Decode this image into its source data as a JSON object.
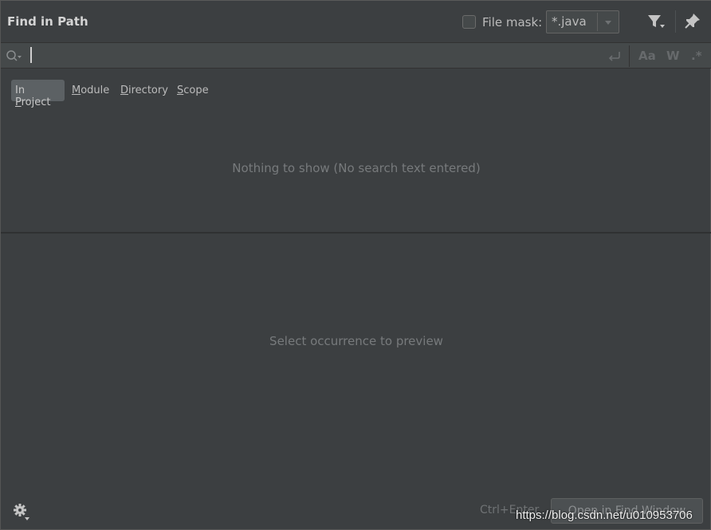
{
  "header": {
    "title": "Find in Path",
    "file_mask_label": "File mask:",
    "file_mask_checked": false,
    "file_mask_value": "*.java",
    "icons": [
      "filter-icon",
      "pin-icon"
    ]
  },
  "search": {
    "value": "",
    "placeholder": "",
    "options": {
      "match_case": "Aa",
      "words": "W",
      "regex": ".*"
    },
    "icons": [
      "search-history-icon",
      "newline-icon"
    ]
  },
  "scopes": {
    "active": "In Project",
    "items": [
      {
        "prefix": "In ",
        "mnemonic": "P",
        "rest": "roject"
      },
      {
        "prefix": "",
        "mnemonic": "M",
        "rest": "odule"
      },
      {
        "prefix": "",
        "mnemonic": "D",
        "rest": "irectory"
      },
      {
        "prefix": "",
        "mnemonic": "S",
        "rest": "cope"
      }
    ]
  },
  "results": {
    "empty_text": "Nothing to show (No search text entered)"
  },
  "preview": {
    "empty_text": "Select occurrence to preview"
  },
  "footer": {
    "shortcut": "Ctrl+Enter",
    "open_button": "Open in Find Window",
    "watermark": "https://blog.csdn.net/u010953706"
  },
  "colors": {
    "background": "#3c3f41",
    "search_bar": "#45494a",
    "active_tab": "#5c6164",
    "text": "#bbbbbb",
    "muted_text": "#777a7c"
  }
}
